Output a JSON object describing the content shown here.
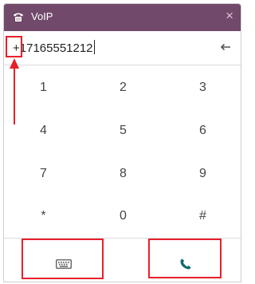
{
  "window": {
    "title": "VoIP",
    "close_label": "×",
    "title_icon": "phone-handset-icon"
  },
  "dialer": {
    "number": "+17165551212",
    "backspace_icon": "backspace-arrow-icon"
  },
  "keypad": {
    "keys": [
      "1",
      "2",
      "3",
      "4",
      "5",
      "6",
      "7",
      "8",
      "9",
      "*",
      "0",
      "#"
    ]
  },
  "footer": {
    "keyboard_icon": "keyboard-icon",
    "call_icon": "phone-call-icon"
  },
  "colors": {
    "titlebar": "#71496a",
    "call_icon": "#0f6b6e",
    "annotation": "#e8202a"
  }
}
